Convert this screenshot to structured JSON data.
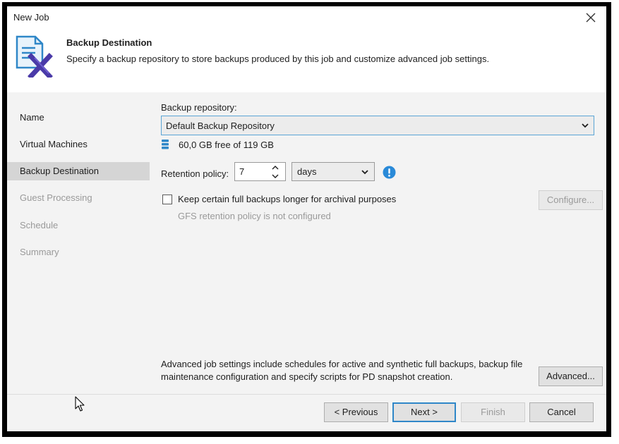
{
  "window": {
    "title": "New Job",
    "close_icon": "close-icon"
  },
  "header": {
    "title": "Backup Destination",
    "description": "Specify a backup repository to store backups produced by this job and customize advanced job settings.",
    "icon": "backup-job-icon"
  },
  "sidebar": {
    "items": [
      {
        "label": "Name",
        "state": "done"
      },
      {
        "label": "Virtual Machines",
        "state": "done"
      },
      {
        "label": "Backup Destination",
        "state": "active"
      },
      {
        "label": "Guest Processing",
        "state": "pending"
      },
      {
        "label": "Schedule",
        "state": "pending"
      },
      {
        "label": "Summary",
        "state": "pending"
      }
    ]
  },
  "repository": {
    "label": "Backup repository:",
    "selected": "Default Backup Repository",
    "free_space": "60,0 GB free of 119 GB"
  },
  "retention": {
    "label": "Retention policy:",
    "value": "7",
    "unit": "days"
  },
  "archival": {
    "checkbox_label": "Keep certain full backups longer for archival purposes",
    "checked": false,
    "note": "GFS retention policy is not configured",
    "configure_label": "Configure..."
  },
  "advanced": {
    "text": "Advanced job settings include schedules for active and synthetic full backups, backup file maintenance configuration and specify scripts for PD snapshot creation.",
    "button_label": "Advanced..."
  },
  "footer": {
    "previous_label": "< Previous",
    "next_label": "Next >",
    "finish_label": "Finish",
    "cancel_label": "Cancel"
  },
  "colors": {
    "accent": "#2f87c8",
    "info": "#2a8ad8",
    "panel": "#f3f3f3",
    "selected_nav": "#d5d5d5"
  }
}
